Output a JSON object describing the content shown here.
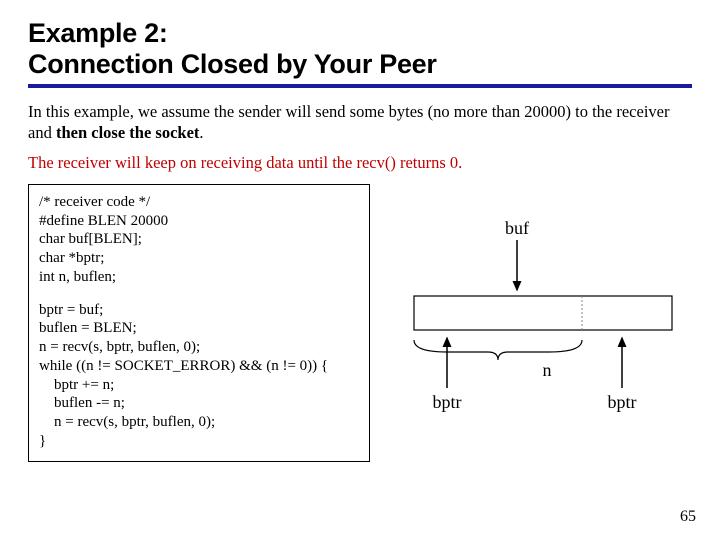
{
  "title_line1": "Example 2:",
  "title_line2": "Connection Closed by Your Peer",
  "para1_prefix": "In this example, we assume the sender will send some bytes (no more than 20000) to the receiver and ",
  "para1_bold": "then close the socket",
  "para1_suffix": ".",
  "para2": "The receiver will keep on receiving data until the recv() returns 0.",
  "code_block1": [
    "/* receiver code */",
    "#define BLEN 20000",
    "char buf[BLEN];",
    "char *bptr;",
    "int n, buflen;"
  ],
  "code_block2": [
    "bptr = buf;",
    "buflen = BLEN;",
    "n = recv(s, bptr, buflen, 0);",
    "while ((n != SOCKET_ERROR) && (n != 0)) {",
    "    bptr += n;",
    "    buflen -= n;",
    "    n = recv(s, bptr, buflen, 0);",
    "}"
  ],
  "diagram": {
    "buf_label": "buf",
    "n_label": "n",
    "bptr_label_left": "bptr",
    "bptr_label_right": "bptr"
  },
  "page_number": "65"
}
